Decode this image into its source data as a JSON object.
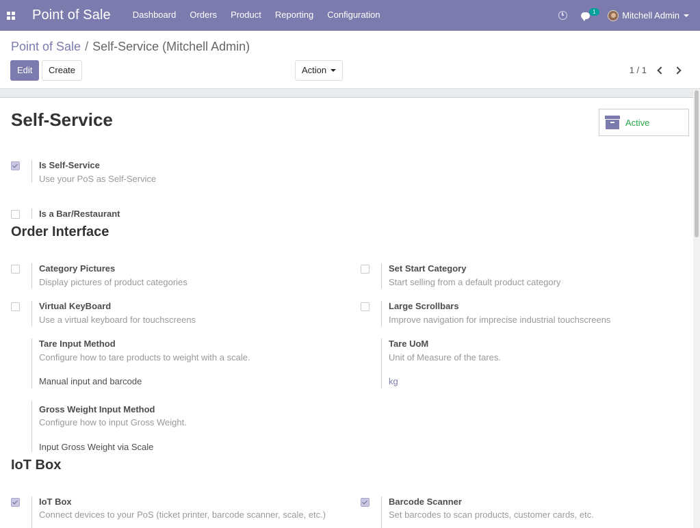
{
  "navbar": {
    "app_name": "Point of Sale",
    "menu": [
      "Dashboard",
      "Orders",
      "Product",
      "Reporting",
      "Configuration"
    ],
    "messages_count": "1",
    "user_name": "Mitchell Admin"
  },
  "control_panel": {
    "breadcrumb_parent": "Point of Sale",
    "breadcrumb_separator": "/",
    "breadcrumb_current": "Self-Service (Mitchell Admin)",
    "edit_label": "Edit",
    "create_label": "Create",
    "action_label": "Action",
    "pager": "1 / 1"
  },
  "form": {
    "title": "Self-Service",
    "active_label": "Active",
    "is_self_service": {
      "label": "Is Self-Service",
      "help": "Use your PoS as Self-Service",
      "checked": true
    },
    "is_bar_restaurant": {
      "label": "Is a Bar/Restaurant",
      "checked": false
    },
    "order_interface": {
      "title": "Order Interface",
      "category_pictures": {
        "label": "Category Pictures",
        "help": "Display pictures of product categories",
        "checked": false
      },
      "set_start_category": {
        "label": "Set Start Category",
        "help": "Start selling from a default product category",
        "checked": false
      },
      "virtual_keyboard": {
        "label": "Virtual KeyBoard",
        "help": "Use a virtual keyboard for touchscreens",
        "checked": false
      },
      "large_scrollbars": {
        "label": "Large Scrollbars",
        "help": "Improve navigation for imprecise industrial touchscreens",
        "checked": false
      },
      "tare_input_method": {
        "label": "Tare Input Method",
        "help": "Configure how to tare products to weight with a scale.",
        "value": "Manual input and barcode"
      },
      "tare_uom": {
        "label": "Tare UoM",
        "help": "Unit of Measure of the tares.",
        "value": "kg"
      },
      "gross_weight_input_method": {
        "label": "Gross Weight Input Method",
        "help": "Configure how to input Gross Weight.",
        "value": "Input Gross Weight via Scale"
      }
    },
    "iot": {
      "title": "IoT Box",
      "iot_box": {
        "label": "IoT Box",
        "help": "Connect devices to your PoS (ticket printer, barcode scanner, scale, etc.)",
        "checked": true
      },
      "barcode_scanner": {
        "label": "Barcode Scanner",
        "help": "Set barcodes to scan products, customer cards, etc.",
        "checked": true
      }
    }
  },
  "colors": {
    "brand": "#7c7bad",
    "active_green": "#28a745"
  }
}
